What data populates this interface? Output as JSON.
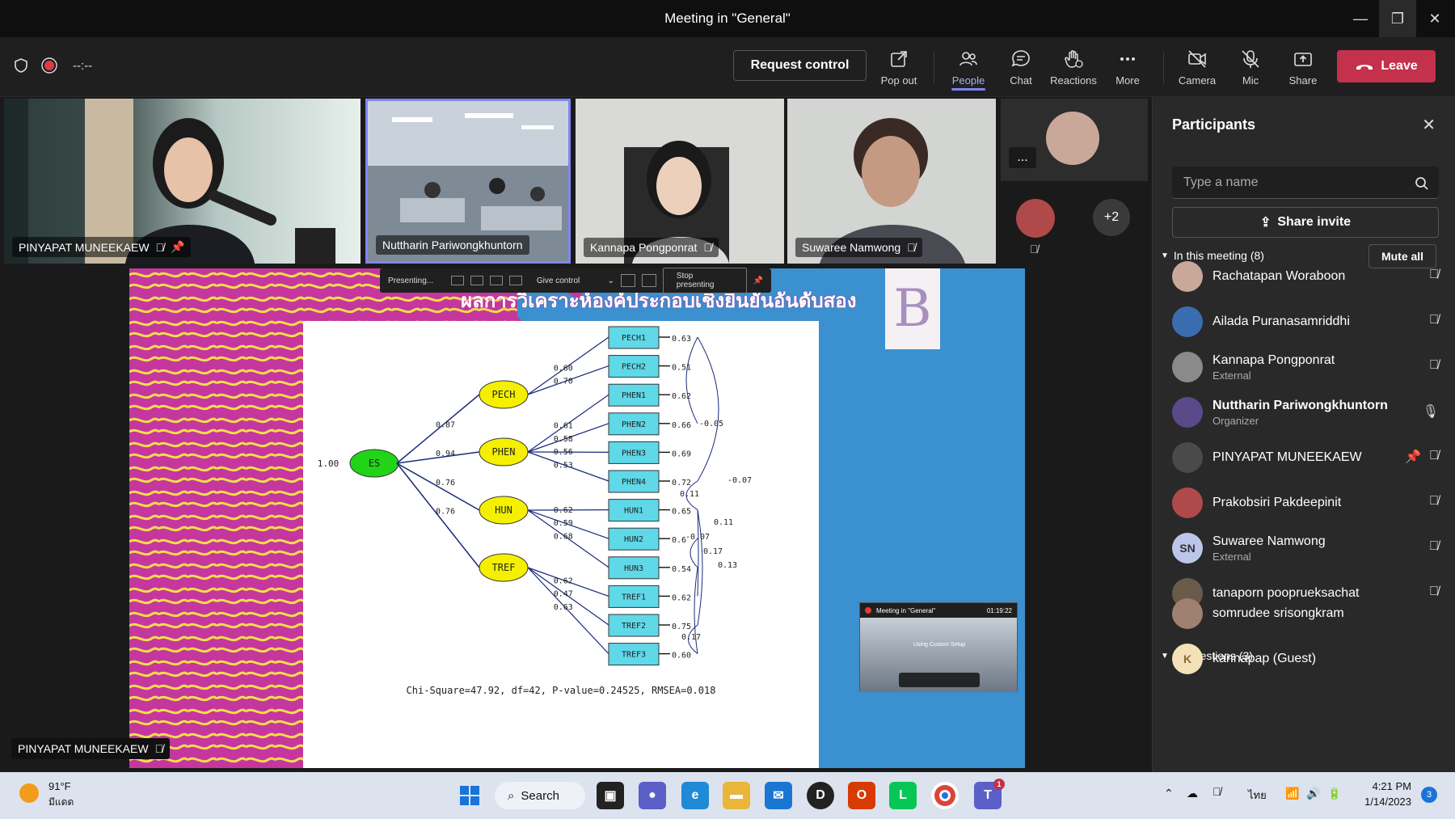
{
  "window": {
    "title": "Meeting in \"General\""
  },
  "toolbar": {
    "timer": "--:--",
    "request_control": "Request control",
    "pop_out": "Pop out",
    "people": "People",
    "chat": "Chat",
    "reactions": "Reactions",
    "more": "More",
    "camera": "Camera",
    "mic": "Mic",
    "share": "Share",
    "leave": "Leave"
  },
  "tiles": [
    {
      "name": "PINYAPAT MUNEEKAEW"
    },
    {
      "name": "Nuttharin Pariwongkhuntorn"
    },
    {
      "name": "Kannapa Pongponrat"
    },
    {
      "name": "Suwaree Namwong"
    }
  ],
  "overflow": {
    "more_count": "+2",
    "dots": "..."
  },
  "share_bar": {
    "presenting": "Presenting...",
    "give_control": "Give control",
    "stop": "Stop presenting"
  },
  "slide": {
    "title": "ผลการวิเคราะห์องค์ประกอบเชิงยืนยันอันดับสอง",
    "logo_letter": "B",
    "footer": "Chi-Square=47.92, df=42, P-value=0.24525, RMSEA=0.018",
    "es": {
      "label": "ES",
      "variance": "1.00"
    },
    "latents": [
      {
        "label": "PECH",
        "path": "0.87"
      },
      {
        "label": "PHEN",
        "path": "0.94"
      },
      {
        "label": "HUN",
        "path": "0.76"
      },
      {
        "label": "TREF",
        "path": "0.76"
      }
    ],
    "observed": [
      {
        "label": "PECH1",
        "err": "0.63"
      },
      {
        "label": "PECH2",
        "err": "0.51"
      },
      {
        "label": "PHEN1",
        "err": "0.62"
      },
      {
        "label": "PHEN2",
        "err": "0.66"
      },
      {
        "label": "PHEN3",
        "err": "0.69"
      },
      {
        "label": "PHEN4",
        "err": "0.72"
      },
      {
        "label": "HUN1",
        "err": "0.65"
      },
      {
        "label": "HUN2",
        "err": "0.6"
      },
      {
        "label": "HUN3",
        "err": "0.54"
      },
      {
        "label": "TREF1",
        "err": "0.62"
      },
      {
        "label": "TREF2",
        "err": "0.75"
      },
      {
        "label": "TREF3",
        "err": "0.60"
      }
    ],
    "loadings": [
      "0.60",
      "0.70",
      "0.61",
      "0.58",
      "0.56",
      "0.53",
      "0.62",
      "0.59",
      "0.68",
      "0.62",
      "0.47",
      "0.63"
    ],
    "covariances": [
      "-0.05",
      "-0.07",
      "0.11",
      "0.11",
      "-0.07",
      "0.17",
      "0.13",
      "0.17"
    ]
  },
  "mini_window": {
    "title": "Meeting in \"General\"",
    "time": "01:19:22",
    "caption": "Using Custom Setup"
  },
  "presenter_label": "PINYAPAT MUNEEKAEW",
  "panel": {
    "title": "Participants",
    "search_placeholder": "Type a name",
    "share_invite": "Share invite",
    "in_meeting": "In this meeting (8)",
    "mute_all": "Mute all",
    "suggestions": "Suggestions (3)",
    "participants": [
      {
        "name": "Rachatapan Woraboon",
        "sub": "",
        "avatar_color": "#c9a89a"
      },
      {
        "name": "Ailada Puranasamriddhi",
        "sub": "",
        "avatar_color": "#3a6db0"
      },
      {
        "name": "Kannapa Pongponrat",
        "sub": "External",
        "avatar_color": "#8a8a8a"
      },
      {
        "name": "Nuttharin Pariwongkhuntorn",
        "sub": "Organizer",
        "avatar_color": "#5a4a8a"
      },
      {
        "name": "PINYAPAT MUNEEKAEW",
        "sub": "",
        "avatar_color": "#4a4a4a"
      },
      {
        "name": "Prakobsiri Pakdeepinit",
        "sub": "",
        "avatar_color": "#b04a4a"
      },
      {
        "name": "Suwaree Namwong",
        "sub": "External",
        "avatar_color": "#bcc6e8",
        "initials": "SN"
      },
      {
        "name": "tanaporn pooprueksachat",
        "sub": "",
        "avatar_color": "#6a5a4a"
      }
    ],
    "suggested": [
      {
        "name": "somrudee srisongkram",
        "avatar_color": "#a08070"
      },
      {
        "name": "kannapap (Guest)",
        "avatar_color": "#f3e2b8",
        "initials": "K"
      }
    ]
  },
  "taskbar": {
    "weather_temp": "91°F",
    "weather_desc": "มีแดด",
    "search": "Search",
    "lang": "ไทย",
    "time": "4:21 PM",
    "date": "1/14/2023",
    "notif": "3",
    "teams_badge": "1"
  }
}
